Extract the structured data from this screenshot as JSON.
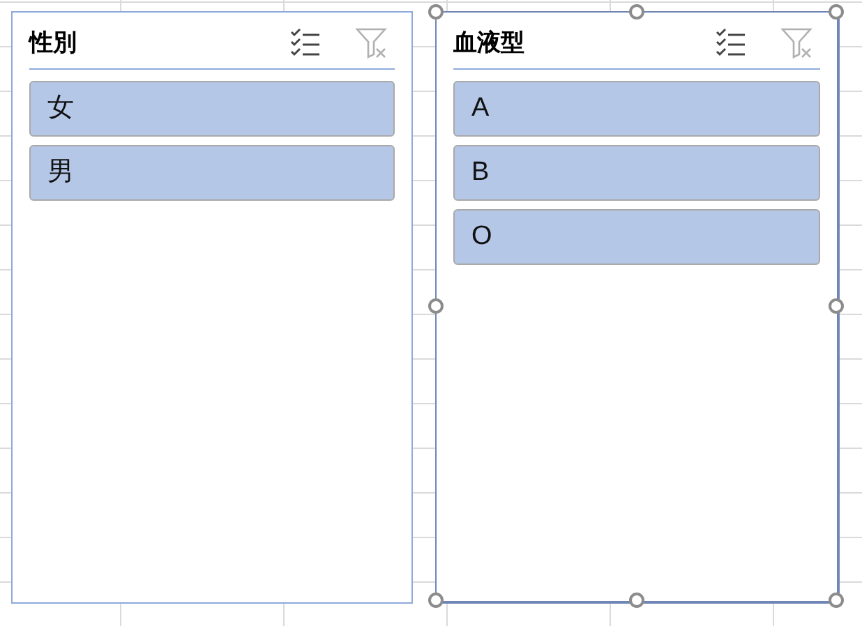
{
  "slicers": [
    {
      "title": "性別",
      "selected": false,
      "multi_select": false,
      "clear_filter_disabled": true,
      "items": [
        {
          "label": "女",
          "selected": true
        },
        {
          "label": "男",
          "selected": true
        }
      ]
    },
    {
      "title": "血液型",
      "selected": true,
      "multi_select": false,
      "clear_filter_disabled": true,
      "items": [
        {
          "label": "A",
          "selected": true
        },
        {
          "label": "B",
          "selected": true
        },
        {
          "label": "O",
          "selected": true
        }
      ]
    }
  ]
}
